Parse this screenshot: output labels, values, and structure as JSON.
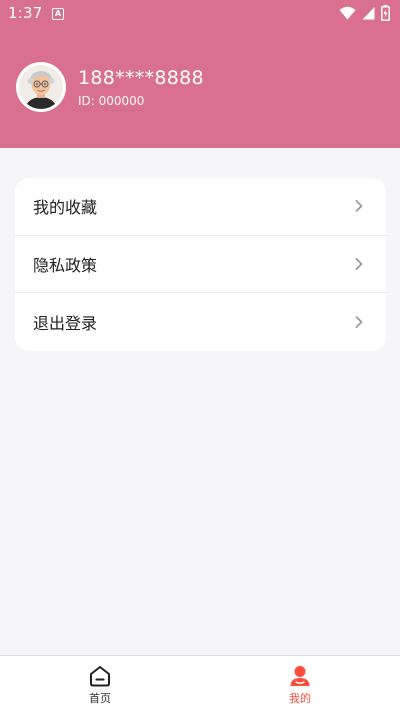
{
  "status_bar": {
    "time": "1:37",
    "notification_letter": "A"
  },
  "profile": {
    "phone": "188****8888",
    "user_id": "ID: 000000"
  },
  "menu": {
    "items": [
      {
        "label": "我的收藏"
      },
      {
        "label": "隐私政策"
      },
      {
        "label": "退出登录"
      }
    ]
  },
  "bottom_nav": {
    "items": [
      {
        "label": "首页",
        "icon": "home-icon",
        "active": false
      },
      {
        "label": "我的",
        "icon": "user-icon",
        "active": true
      }
    ]
  },
  "colors": {
    "header": "#d9708f",
    "active": "#ff4d3d",
    "background": "#f6f6f8"
  }
}
